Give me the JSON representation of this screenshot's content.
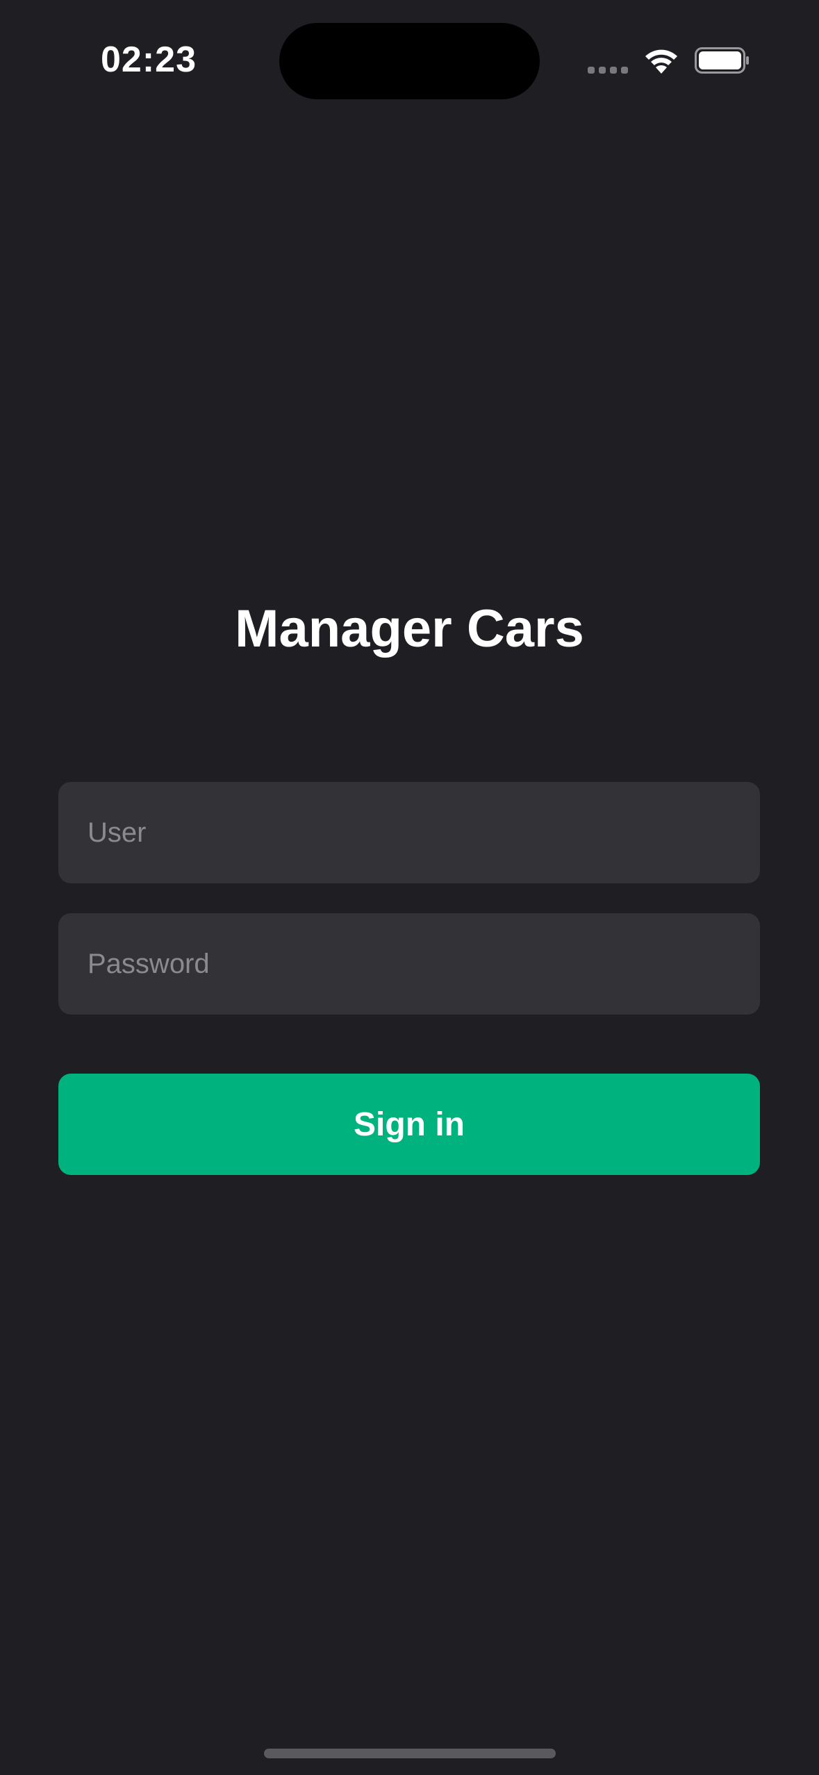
{
  "status_bar": {
    "time": "02:23",
    "signal_icon": "cellular-signal-icon",
    "wifi_icon": "wifi-icon",
    "battery_icon": "battery-icon",
    "battery_level": 1.0
  },
  "app": {
    "title": "Manager Cars"
  },
  "form": {
    "user_placeholder": "User",
    "user_value": "",
    "password_placeholder": "Password",
    "password_value": "",
    "sign_in_label": "Sign in"
  },
  "colors": {
    "background": "#1f1f23",
    "field_background": "#323237",
    "accent": "#00b37e",
    "placeholder": "#8a8a8f"
  }
}
